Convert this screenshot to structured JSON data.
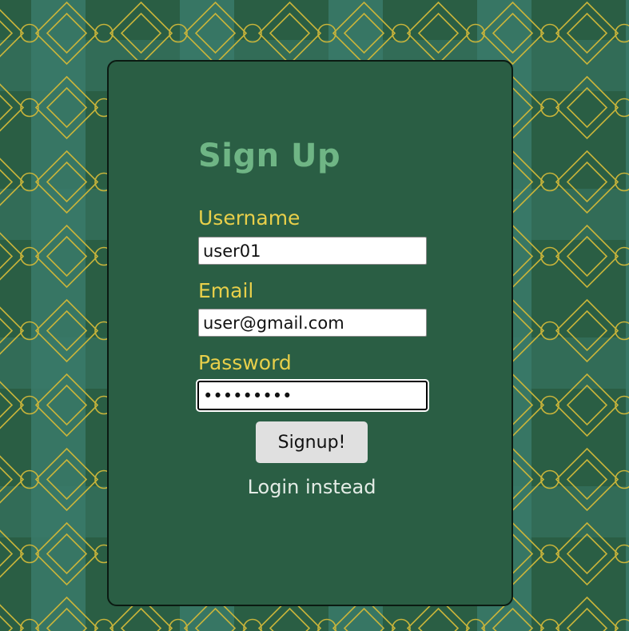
{
  "form": {
    "title": "Sign Up",
    "username": {
      "label": "Username",
      "value": "user01"
    },
    "email": {
      "label": "Email",
      "value": "user@gmail.com"
    },
    "password": {
      "label": "Password",
      "value": "•••••••••"
    },
    "submit_label": "Signup!",
    "alt_link": "Login instead"
  },
  "colors": {
    "background": "#2a5e44",
    "background_alt": "#3a7a6a",
    "pattern_line": "#c8b43a",
    "title": "#6fb585",
    "label": "#e8cf4a",
    "button": "#e0e0e0",
    "link": "#e4ece6"
  }
}
